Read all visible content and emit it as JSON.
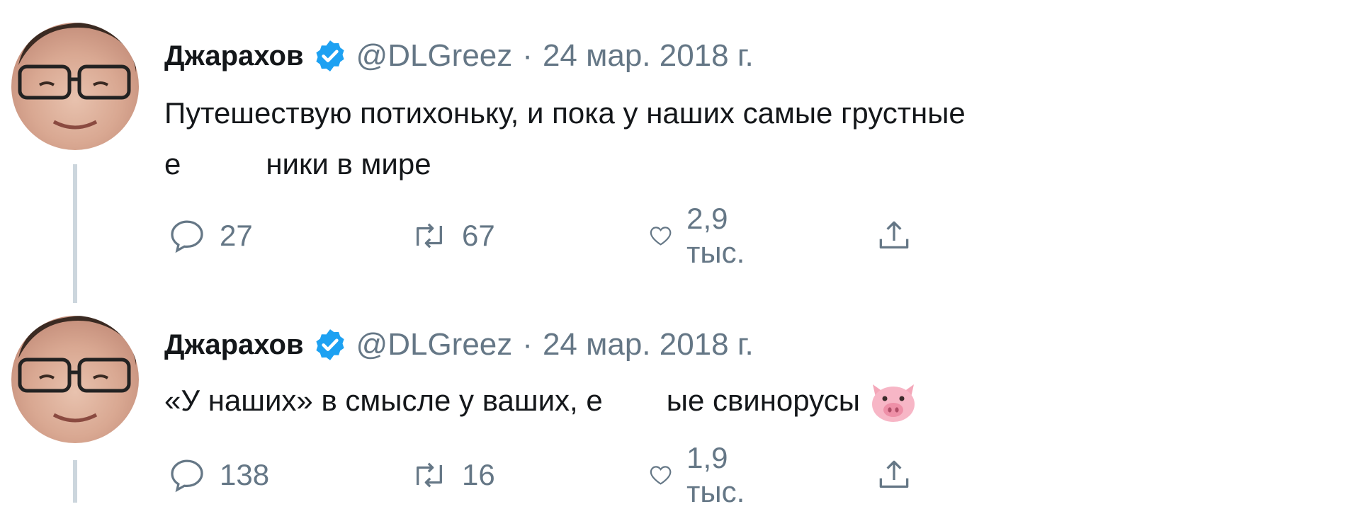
{
  "tweets": [
    {
      "author": {
        "name": "Джарахов",
        "handle": "@DLGreez",
        "verified": true
      },
      "separator": "·",
      "date": "24 мар. 2018 г.",
      "text_part1": "Путешествую потихоньку, и пока у наших самые грустные",
      "text_part2_a": "е",
      "text_part2_b": "ники в мире",
      "actions": {
        "replies": "27",
        "retweets": "67",
        "likes": "2,9 тыс."
      }
    },
    {
      "author": {
        "name": "Джарахов",
        "handle": "@DLGreez",
        "verified": true
      },
      "separator": "·",
      "date": "24 мар. 2018 г.",
      "text_part1": "«У наших» в смысле у ваших, е",
      "text_part2": "ые свинорусы",
      "emoji": "pig-face",
      "actions": {
        "replies": "138",
        "retweets": "16",
        "likes": "1,9 тыс."
      }
    }
  ],
  "colors": {
    "verified": "#1da1f2",
    "muted": "#657786",
    "text": "#14171a",
    "thread": "#ccd6dd"
  }
}
